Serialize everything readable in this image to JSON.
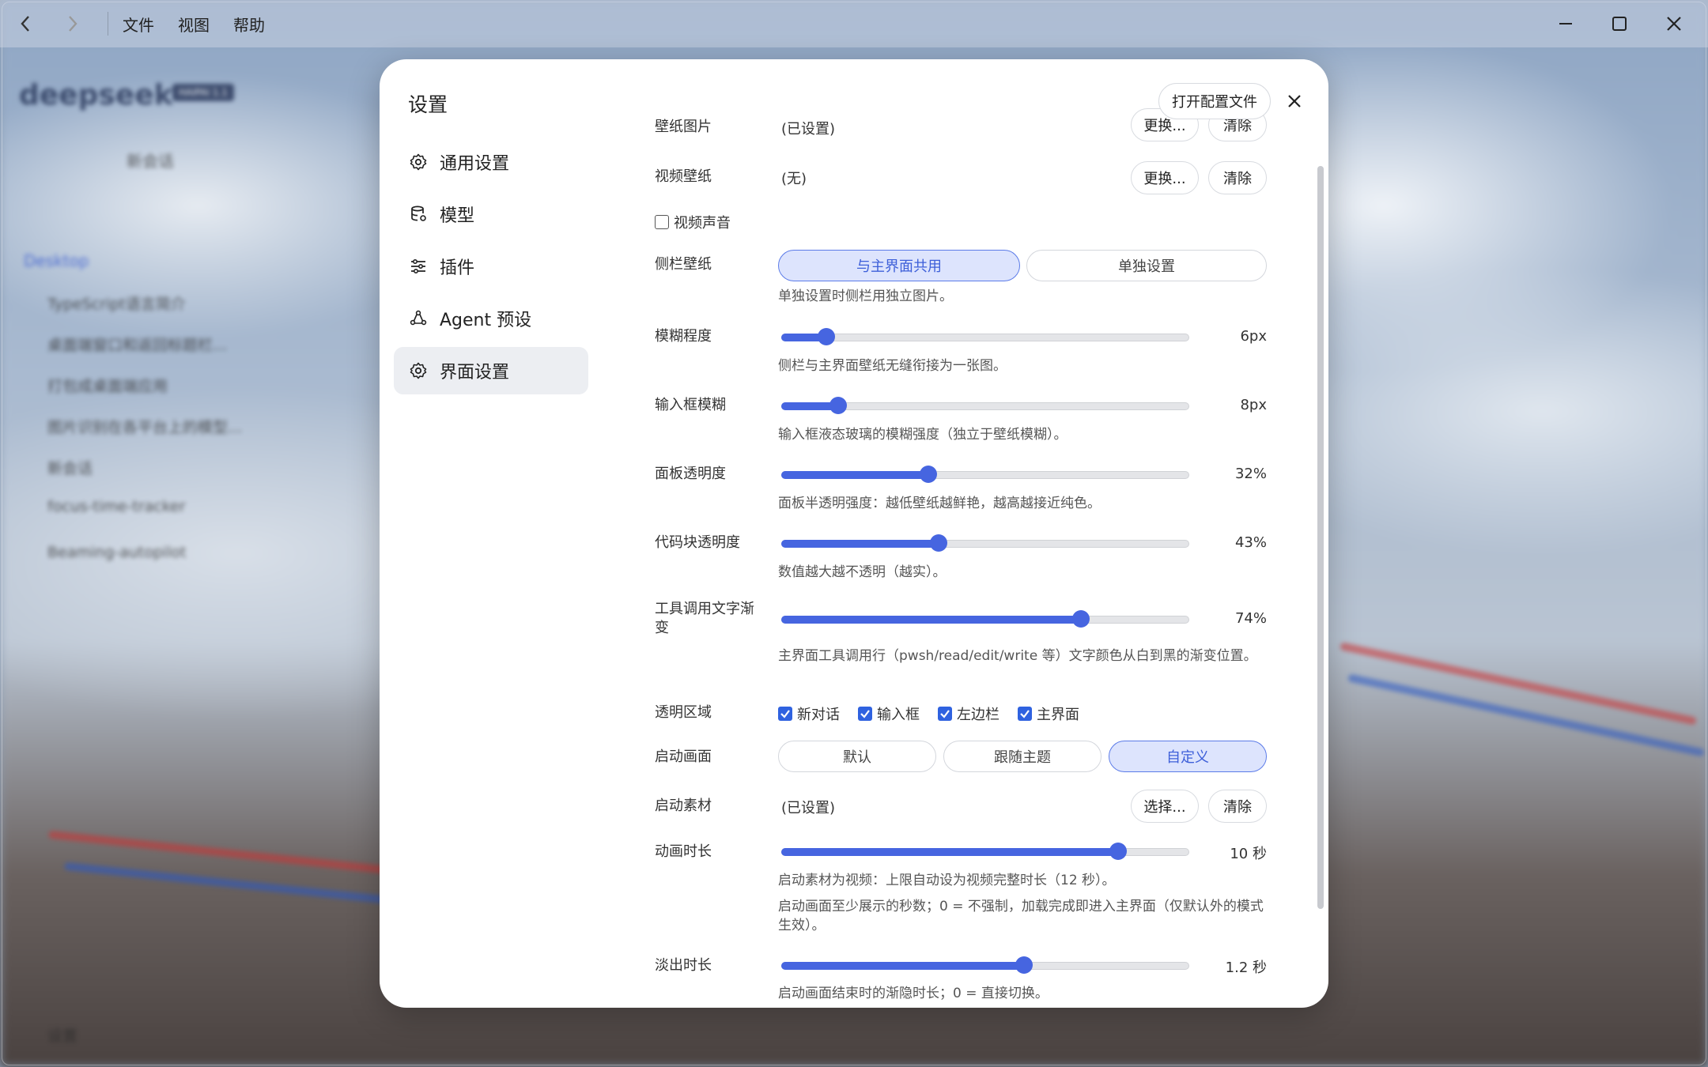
{
  "titlebar": {
    "back_icon": "chevron-left-icon",
    "forward_icon": "chevron-right-icon",
    "menus": [
      "文件",
      "视图",
      "帮助"
    ],
    "controls": [
      "minimize-icon",
      "maximize-icon",
      "close-icon"
    ]
  },
  "background_sidebar": {
    "logo": "deepseek",
    "badge": "HAIPAI 1.1",
    "new_chat": "新会话",
    "folder": "Desktop",
    "items": [
      "TypeScript语言简介",
      "桌面端窗口和返回标题栏...",
      "打包成桌面端应用",
      "图片识别在各平台上的模型...",
      "新会话",
      "focus-time-tracker",
      "Beaming-autopilot"
    ],
    "settings_label": "设置"
  },
  "modal": {
    "title": "设置",
    "open_config_label": "打开配置文件",
    "close_icon": "close-icon",
    "nav": [
      {
        "label": "通用设置",
        "icon": "gear-icon"
      },
      {
        "label": "模型",
        "icon": "database-icon"
      },
      {
        "label": "插件",
        "icon": "sliders-icon"
      },
      {
        "label": "Agent 预设",
        "icon": "agent-icon"
      },
      {
        "label": "界面设置",
        "icon": "gear-icon"
      }
    ],
    "wallpaper_image": {
      "label": "壁纸图片",
      "value": "(已设置)",
      "change": "更换...",
      "clear": "清除"
    },
    "video_wallpaper": {
      "label": "视频壁纸",
      "value": "(无)",
      "change": "更换...",
      "clear": "清除"
    },
    "video_sound": {
      "label": "视频声音",
      "checked": false
    },
    "sidebar_wallpaper": {
      "label": "侧栏壁纸",
      "options": [
        "与主界面共用",
        "单独设置"
      ],
      "selected": "与主界面共用",
      "hint": "单独设置时侧栏用独立图片。"
    },
    "blur": {
      "label": "模糊程度",
      "value_text": "6px",
      "fraction": 0.11,
      "hint": "侧栏与主界面壁纸无缝衔接为一张图。"
    },
    "input_blur": {
      "label": "输入框模糊",
      "value_text": "8px",
      "fraction": 0.14,
      "hint": "输入框液态玻璃的模糊强度（独立于壁纸模糊）。"
    },
    "panel_opacity": {
      "label": "面板透明度",
      "value_text": "32%",
      "fraction": 0.36,
      "hint": "面板半透明强度：越低壁纸越鲜艳，越高越接近纯色。"
    },
    "code_opacity": {
      "label": "代码块透明度",
      "value_text": "43%",
      "fraction": 0.385,
      "hint": "数值越大越不透明（越实）。"
    },
    "tool_gradient": {
      "label": "工具调用文字渐变",
      "value_text": "74%",
      "fraction": 0.735,
      "hint": "主界面工具调用行（pwsh/read/edit/write 等）文字颜色从白到黑的渐变位置。"
    },
    "transparent_areas": {
      "label": "透明区域",
      "items": [
        {
          "label": "新对话",
          "checked": true
        },
        {
          "label": "输入框",
          "checked": true
        },
        {
          "label": "左边栏",
          "checked": true
        },
        {
          "label": "主界面",
          "checked": true
        }
      ]
    },
    "splash": {
      "label": "启动画面",
      "options": [
        "默认",
        "跟随主题",
        "自定义"
      ],
      "selected": "自定义"
    },
    "splash_asset": {
      "label": "启动素材",
      "value": "(已设置)",
      "choose": "选择...",
      "clear": "清除"
    },
    "anim_duration": {
      "label": "动画时长",
      "value_text": "10 秒",
      "fraction": 0.825,
      "hint1": "启动素材为视频：上限自动设为视频完整时长（12 秒）。",
      "hint2": "启动画面至少展示的秒数；0 = 不强制，加载完成即进入主界面（仅默认外的模式生效）。"
    },
    "fade_duration": {
      "label": "淡出时长",
      "value_text": "1.2 秒",
      "fraction": 0.595,
      "hint": "启动画面结束时的渐隐时长；0 = 直接切换。"
    }
  }
}
